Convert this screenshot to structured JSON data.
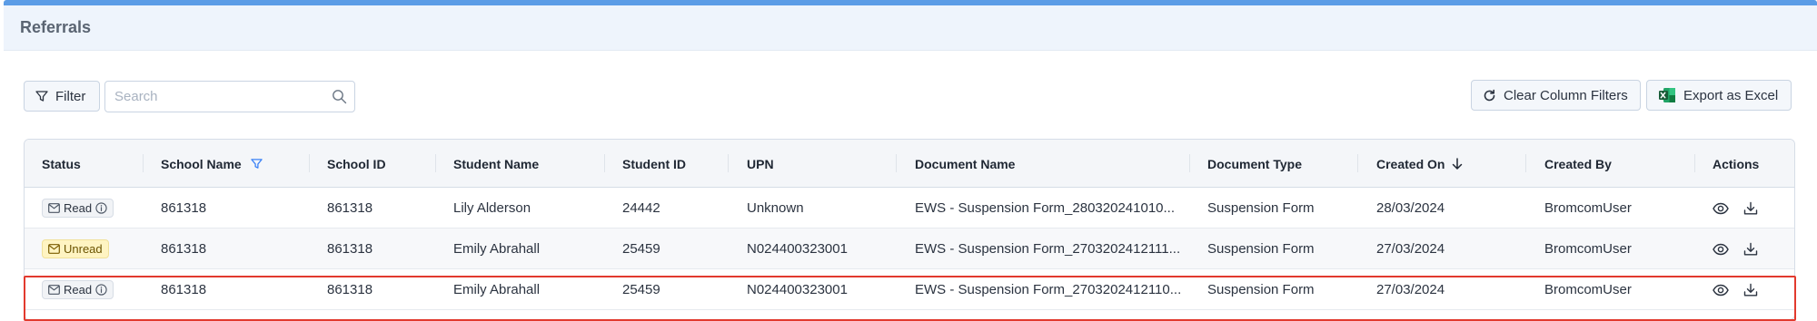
{
  "page": {
    "title": "Referrals"
  },
  "toolbar": {
    "filter_label": "Filter",
    "search_placeholder": "Search",
    "clear_label": "Clear Column Filters",
    "export_label": "Export as Excel"
  },
  "table": {
    "columns": [
      "Status",
      "School Name",
      "School ID",
      "Student Name",
      "Student ID",
      "UPN",
      "Document Name",
      "Document Type",
      "Created On",
      "Created By",
      "Actions"
    ],
    "rows": [
      {
        "status": "Read",
        "school_name": "861318",
        "school_id": "861318",
        "student_name": "Lily Alderson",
        "student_id": "24442",
        "upn": "Unknown",
        "document_name": "EWS - Suspension Form_280320241010...",
        "document_type": "Suspension Form",
        "created_on": "28/03/2024",
        "created_by": "BromcomUser"
      },
      {
        "status": "Unread",
        "school_name": "861318",
        "school_id": "861318",
        "student_name": "Emily Abrahall",
        "student_id": "25459",
        "upn": "N024400323001",
        "document_name": "EWS - Suspension Form_2703202412111...",
        "document_type": "Suspension Form",
        "created_on": "27/03/2024",
        "created_by": "BromcomUser"
      },
      {
        "status": "Read",
        "school_name": "861318",
        "school_id": "861318",
        "student_name": "Emily Abrahall",
        "student_id": "25459",
        "upn": "N024400323001",
        "document_name": "EWS - Suspension Form_2703202412110...",
        "document_type": "Suspension Form",
        "created_on": "27/03/2024",
        "created_by": "BromcomUser"
      }
    ]
  },
  "icons": {
    "filter": "filter-icon",
    "search": "search-icon",
    "refresh": "refresh-icon",
    "excel": "excel-icon",
    "sort": "arrow-down-icon",
    "envelope": "envelope-icon",
    "info": "info-icon",
    "eye": "eye-icon",
    "download": "download-icon"
  },
  "colors": {
    "accent": "#5b9ce6",
    "highlight": "#e23a2e",
    "unread_bg": "#fff4c2",
    "excel_green": "#1e7145"
  }
}
